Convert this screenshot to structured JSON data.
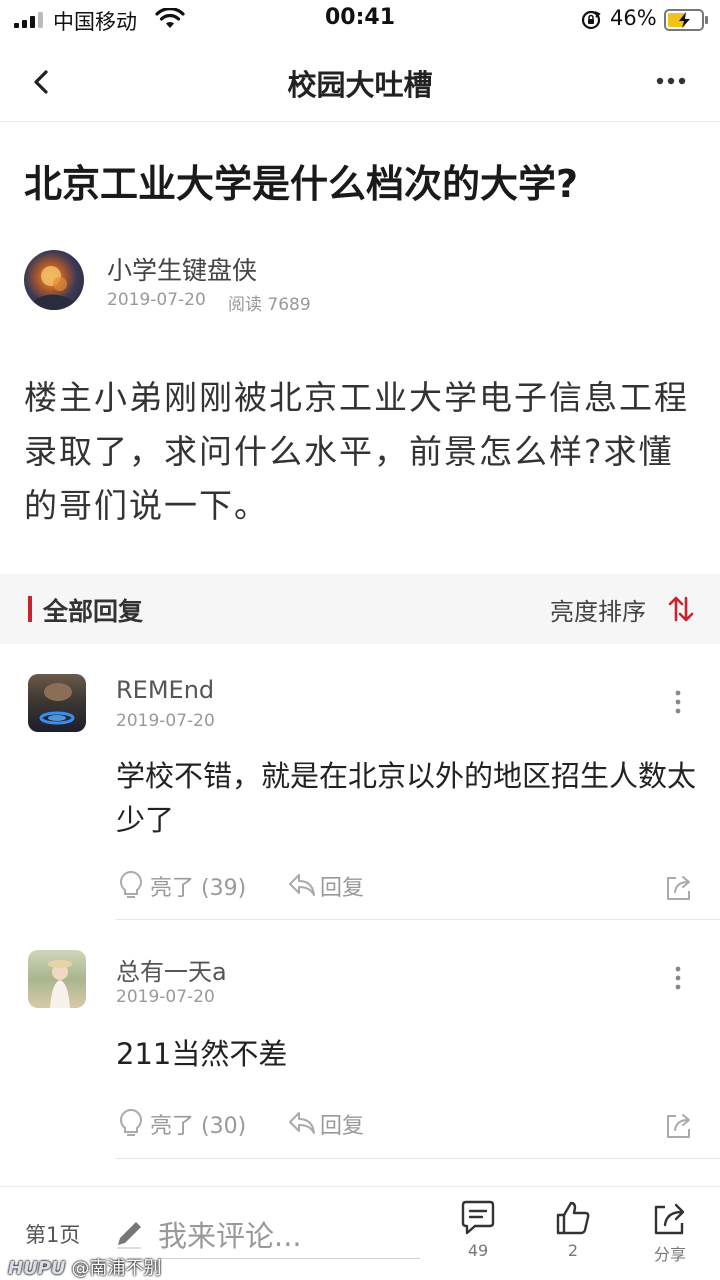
{
  "status_bar": {
    "carrier": "中国移动",
    "time": "00:41",
    "battery": "46%"
  },
  "header": {
    "title": "校园大吐槽"
  },
  "post": {
    "title": "北京工业大学是什么档次的大学?",
    "author": "小学生键盘侠",
    "date": "2019-07-20",
    "reads": "阅读 7689",
    "body": "楼主小弟刚刚被北京工业大学电子信息工程录取了，求问什么水平，前景怎么样?求懂的哥们说一下。"
  },
  "replies_bar": {
    "label": "全部回复",
    "sort_label": "亮度排序",
    "accent_color": "#c8242f"
  },
  "comments": [
    {
      "author": "REMEnd",
      "date": "2019-07-20",
      "text": "学校不错，就是在北京以外的地区招生人数太少了",
      "like_label": "亮了 (39)",
      "reply_label": "回复"
    },
    {
      "author": "总有一天a",
      "date": "2019-07-20",
      "text": "211当然不差",
      "like_label": "亮了 (30)",
      "reply_label": "回复"
    }
  ],
  "bottom_bar": {
    "page_label": "第1页",
    "comment_placeholder": "我来评论...",
    "comment_count": "49",
    "like_count": "2",
    "share_label": "分享"
  },
  "watermark": {
    "logo": "HUPU",
    "text": "@南浦不别"
  }
}
